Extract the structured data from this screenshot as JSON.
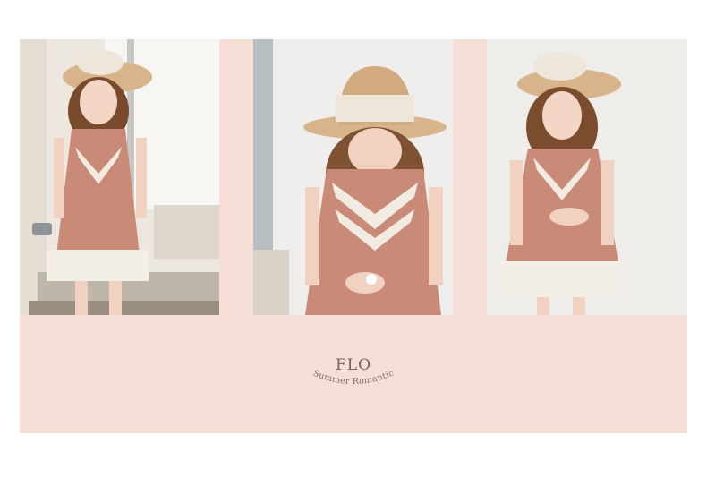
{
  "brand": {
    "name": "FLO",
    "tagline": "Summer Romantic"
  },
  "colors": {
    "panel": "#f6ddd6",
    "dress": "#c98a78",
    "lace": "#f4efe6",
    "hat": "#d9b48a"
  },
  "photos": [
    {
      "subject": "girl in pink lace dress holding watering can"
    },
    {
      "subject": "girl in straw hat looking down at flower"
    },
    {
      "subject": "girl in pink dress standing against white wall"
    }
  ]
}
